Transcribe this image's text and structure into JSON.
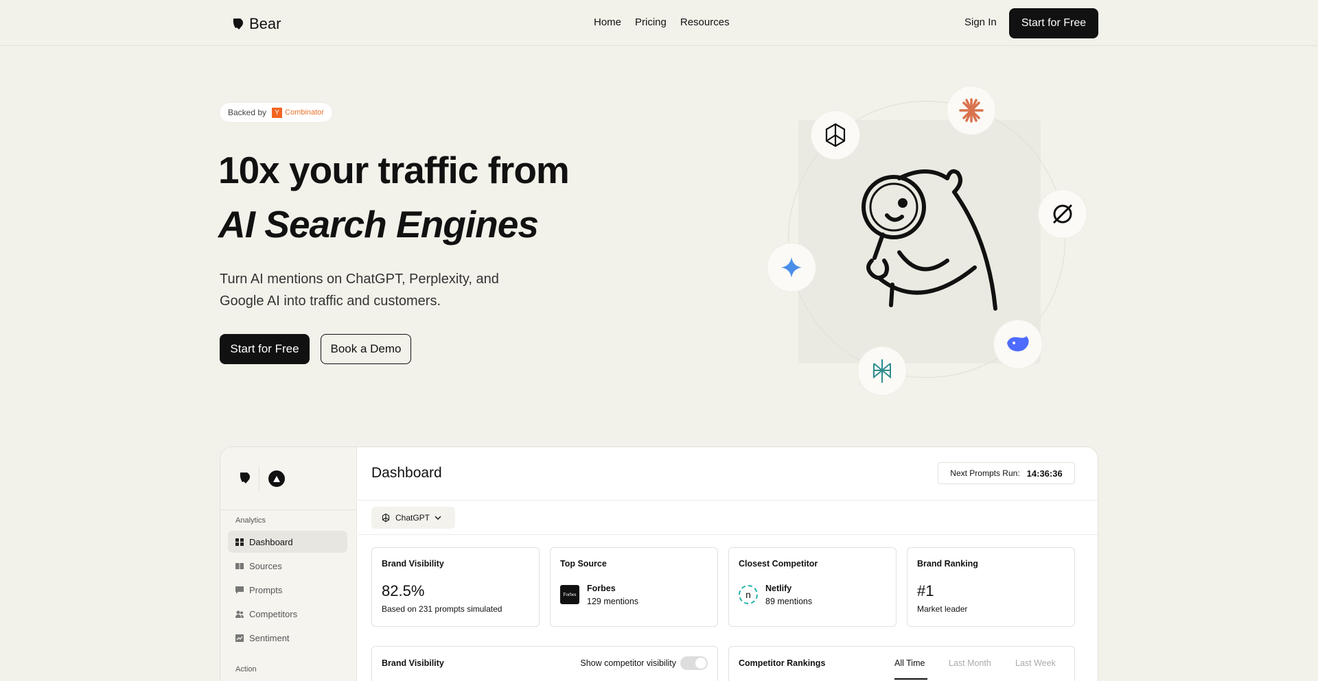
{
  "nav": {
    "brand": "Bear",
    "links": [
      "Home",
      "Pricing",
      "Resources"
    ],
    "sign_in": "Sign In",
    "cta": "Start for Free"
  },
  "hero": {
    "backed_by": "Backed by",
    "yc_letter": "Y",
    "yc_text": "Combinator",
    "title_line1": "10x your traffic from",
    "title_line2": "AI Search Engines",
    "subtitle": "Turn AI mentions on ChatGPT, Perplexity, and Google AI into traffic and customers.",
    "primary_button": "Start for Free",
    "secondary_button": "Book a Demo"
  },
  "illustration": {
    "icons": [
      "openai-icon",
      "claude-icon",
      "grok-icon",
      "gemini-icon",
      "deepseek-icon",
      "perplexity-icon"
    ]
  },
  "dashboard": {
    "title": "Dashboard",
    "next_run_label": "Next Prompts Run:",
    "next_run_time": "14:36:36",
    "model": "ChatGPT",
    "sidebar": {
      "section_analytics": "Analytics",
      "items": [
        {
          "label": "Dashboard",
          "icon": "grid-icon"
        },
        {
          "label": "Sources",
          "icon": "book-icon"
        },
        {
          "label": "Prompts",
          "icon": "chat-icon"
        },
        {
          "label": "Competitors",
          "icon": "users-icon"
        },
        {
          "label": "Sentiment",
          "icon": "chart-icon"
        }
      ],
      "section_action": "Action"
    },
    "cards": {
      "visibility": {
        "title": "Brand Visibility",
        "value": "82.5%",
        "sub": "Based on 231 prompts simulated"
      },
      "top_source": {
        "title": "Top Source",
        "name": "Forbes",
        "logo_text": "Forbes",
        "count": "129 mentions"
      },
      "competitor": {
        "title": "Closest Competitor",
        "name": "Netlify",
        "logo_text": "n",
        "count": "89 mentions"
      },
      "ranking": {
        "title": "Brand Ranking",
        "value": "#1",
        "sub": "Market leader"
      }
    },
    "panels": {
      "visibility_title": "Brand Visibility",
      "toggle_label": "Show competitor visibility",
      "rankings_title": "Competitor Rankings",
      "ranges": [
        "All Time",
        "Last Month",
        "Last Week"
      ]
    }
  }
}
